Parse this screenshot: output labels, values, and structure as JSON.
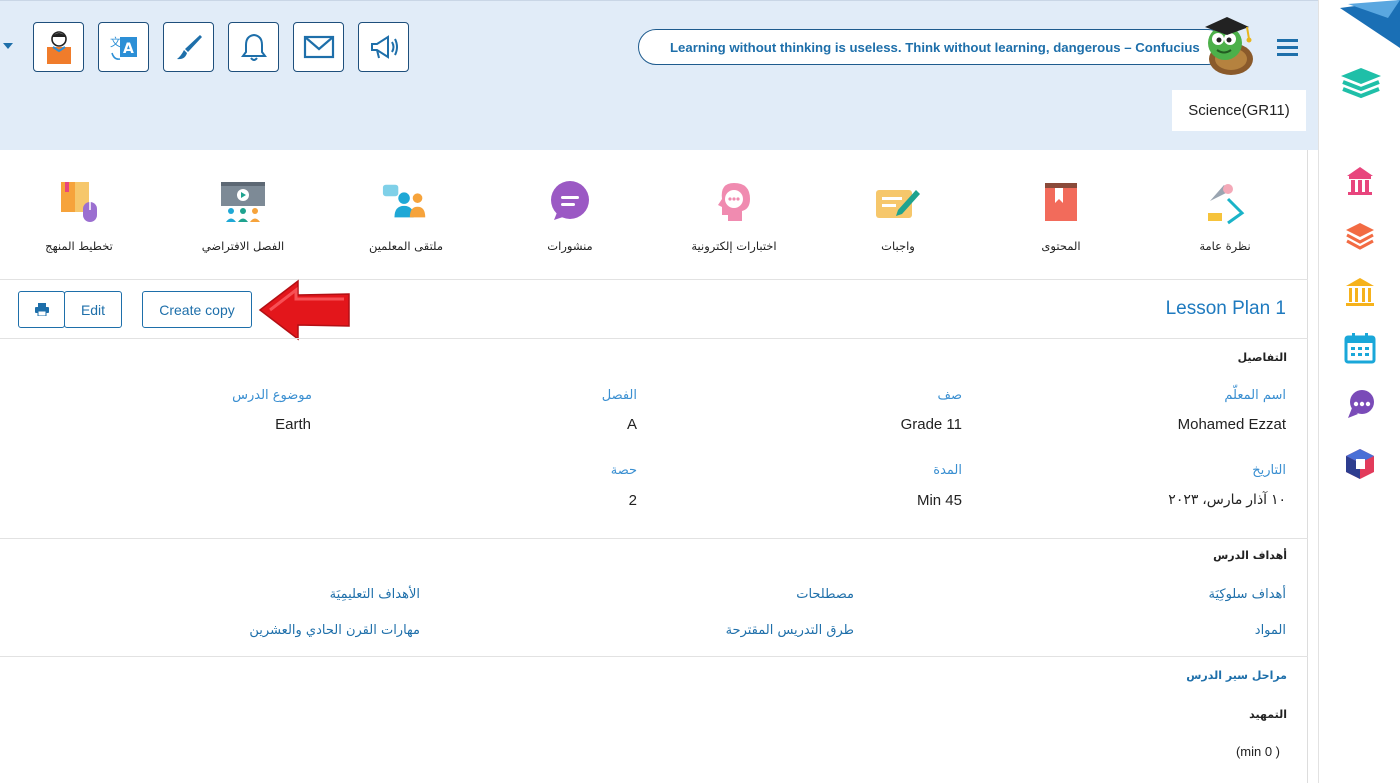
{
  "header": {
    "quote": "Learning without thinking is useless. Think without learning, dangerous – Confucius",
    "course": "Science(GR11)"
  },
  "toolbar": {
    "buttons": [
      {
        "icon": "student-avatar-icon"
      },
      {
        "icon": "translate-icon"
      },
      {
        "icon": "paintbrush-icon"
      },
      {
        "icon": "bell-icon"
      },
      {
        "icon": "mail-icon"
      },
      {
        "icon": "megaphone-icon"
      }
    ]
  },
  "nav": {
    "items": [
      {
        "label": "نظرة عامة",
        "icon": "overview-icon"
      },
      {
        "label": "المحتوى",
        "icon": "content-book-icon"
      },
      {
        "label": "واجبات",
        "icon": "assignment-icon"
      },
      {
        "label": "اختبارات إلكترونية",
        "icon": "online-tests-icon"
      },
      {
        "label": "منشورات",
        "icon": "posts-chat-icon"
      },
      {
        "label": "ملتقى المعلمين",
        "icon": "teachers-forum-icon"
      },
      {
        "label": "الفصل الافتراضي",
        "icon": "virtual-class-icon"
      },
      {
        "label": "تخطيط المنهج",
        "icon": "curriculum-planning-icon"
      }
    ]
  },
  "actions": {
    "edit": "Edit",
    "create_copy": "Create copy"
  },
  "lesson": {
    "title": "Lesson Plan 1",
    "details_title": "التفاصيل",
    "fields": {
      "teacher_label": "اسم المعلّم",
      "teacher": "Mohamed Ezzat",
      "grade_label": "صف",
      "grade": "Grade 11",
      "section_label": "الفصل",
      "section": "A",
      "topic_label": "موضوع الدرس",
      "topic": "Earth",
      "date_label": "التاريخ",
      "date": "١٠ آذار مارس، ٢٠٢٣",
      "duration_label": "المدة",
      "duration": "Min 45",
      "period_label": "حصة",
      "period": "2"
    },
    "objectives_title": "أهداف الدرس",
    "objective_links": {
      "behavioral": "أهداف سلوكِيَة",
      "terms": "مصطلحات",
      "educational": "الأهداف التعليمِيَة",
      "materials": "المواد",
      "methods": "طرق التدريس المقترحة",
      "skills": "مهارات القرن الحادي والعشرين"
    },
    "stages_title": "مراحل سير الدرس",
    "intro_title": "التمهيد",
    "intro_duration": "(min 0 )"
  },
  "colors": {
    "accent": "#1e6faa",
    "header_bg": "#e1ecf8",
    "arrow": "#e3161b"
  }
}
